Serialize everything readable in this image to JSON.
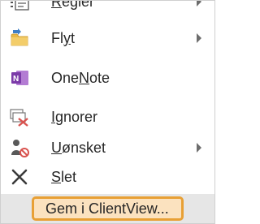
{
  "menu": {
    "items": [
      {
        "label": "Regler",
        "icon": "rules-icon",
        "has_submenu": true
      },
      {
        "label": "Flyt",
        "icon": "folder-move-icon",
        "has_submenu": true
      },
      {
        "label": "OneNote",
        "icon": "onenote-icon",
        "has_submenu": false
      },
      {
        "label": "Ignorer",
        "icon": "ignore-conversation-icon",
        "has_submenu": false
      },
      {
        "label": "Uønsket",
        "icon": "junk-email-icon",
        "has_submenu": true
      },
      {
        "label": "Slet",
        "icon": "delete-icon",
        "has_submenu": false
      }
    ],
    "highlighted": {
      "label": "Gem i ClientView..."
    }
  },
  "colors": {
    "highlight_border": "#e8a035",
    "highlight_fill": "#fbe2bf",
    "hover_background": "#e6e6e6",
    "text": "#262626"
  }
}
